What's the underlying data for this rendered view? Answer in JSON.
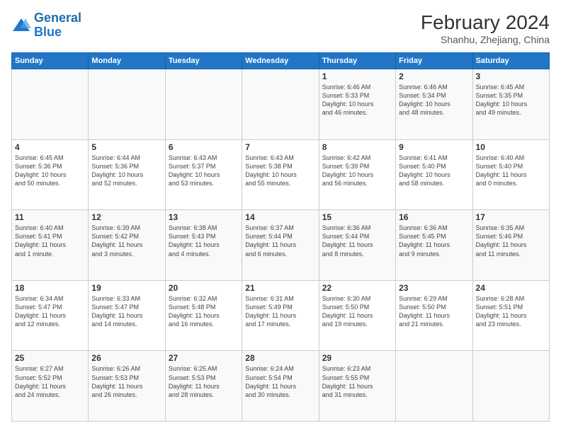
{
  "logo": {
    "line1": "General",
    "line2": "Blue"
  },
  "header": {
    "month_year": "February 2024",
    "location": "Shanhu, Zhejiang, China"
  },
  "weekdays": [
    "Sunday",
    "Monday",
    "Tuesday",
    "Wednesday",
    "Thursday",
    "Friday",
    "Saturday"
  ],
  "weeks": [
    [
      {
        "day": "",
        "info": ""
      },
      {
        "day": "",
        "info": ""
      },
      {
        "day": "",
        "info": ""
      },
      {
        "day": "",
        "info": ""
      },
      {
        "day": "1",
        "info": "Sunrise: 6:46 AM\nSunset: 5:33 PM\nDaylight: 10 hours\nand 46 minutes."
      },
      {
        "day": "2",
        "info": "Sunrise: 6:46 AM\nSunset: 5:34 PM\nDaylight: 10 hours\nand 48 minutes."
      },
      {
        "day": "3",
        "info": "Sunrise: 6:45 AM\nSunset: 5:35 PM\nDaylight: 10 hours\nand 49 minutes."
      }
    ],
    [
      {
        "day": "4",
        "info": "Sunrise: 6:45 AM\nSunset: 5:36 PM\nDaylight: 10 hours\nand 50 minutes."
      },
      {
        "day": "5",
        "info": "Sunrise: 6:44 AM\nSunset: 5:36 PM\nDaylight: 10 hours\nand 52 minutes."
      },
      {
        "day": "6",
        "info": "Sunrise: 6:43 AM\nSunset: 5:37 PM\nDaylight: 10 hours\nand 53 minutes."
      },
      {
        "day": "7",
        "info": "Sunrise: 6:43 AM\nSunset: 5:38 PM\nDaylight: 10 hours\nand 55 minutes."
      },
      {
        "day": "8",
        "info": "Sunrise: 6:42 AM\nSunset: 5:39 PM\nDaylight: 10 hours\nand 56 minutes."
      },
      {
        "day": "9",
        "info": "Sunrise: 6:41 AM\nSunset: 5:40 PM\nDaylight: 10 hours\nand 58 minutes."
      },
      {
        "day": "10",
        "info": "Sunrise: 6:40 AM\nSunset: 5:40 PM\nDaylight: 11 hours\nand 0 minutes."
      }
    ],
    [
      {
        "day": "11",
        "info": "Sunrise: 6:40 AM\nSunset: 5:41 PM\nDaylight: 11 hours\nand 1 minute."
      },
      {
        "day": "12",
        "info": "Sunrise: 6:39 AM\nSunset: 5:42 PM\nDaylight: 11 hours\nand 3 minutes."
      },
      {
        "day": "13",
        "info": "Sunrise: 6:38 AM\nSunset: 5:43 PM\nDaylight: 11 hours\nand 4 minutes."
      },
      {
        "day": "14",
        "info": "Sunrise: 6:37 AM\nSunset: 5:44 PM\nDaylight: 11 hours\nand 6 minutes."
      },
      {
        "day": "15",
        "info": "Sunrise: 6:36 AM\nSunset: 5:44 PM\nDaylight: 11 hours\nand 8 minutes."
      },
      {
        "day": "16",
        "info": "Sunrise: 6:36 AM\nSunset: 5:45 PM\nDaylight: 11 hours\nand 9 minutes."
      },
      {
        "day": "17",
        "info": "Sunrise: 6:35 AM\nSunset: 5:46 PM\nDaylight: 11 hours\nand 11 minutes."
      }
    ],
    [
      {
        "day": "18",
        "info": "Sunrise: 6:34 AM\nSunset: 5:47 PM\nDaylight: 11 hours\nand 12 minutes."
      },
      {
        "day": "19",
        "info": "Sunrise: 6:33 AM\nSunset: 5:47 PM\nDaylight: 11 hours\nand 14 minutes."
      },
      {
        "day": "20",
        "info": "Sunrise: 6:32 AM\nSunset: 5:48 PM\nDaylight: 11 hours\nand 16 minutes."
      },
      {
        "day": "21",
        "info": "Sunrise: 6:31 AM\nSunset: 5:49 PM\nDaylight: 11 hours\nand 17 minutes."
      },
      {
        "day": "22",
        "info": "Sunrise: 6:30 AM\nSunset: 5:50 PM\nDaylight: 11 hours\nand 19 minutes."
      },
      {
        "day": "23",
        "info": "Sunrise: 6:29 AM\nSunset: 5:50 PM\nDaylight: 11 hours\nand 21 minutes."
      },
      {
        "day": "24",
        "info": "Sunrise: 6:28 AM\nSunset: 5:51 PM\nDaylight: 11 hours\nand 23 minutes."
      }
    ],
    [
      {
        "day": "25",
        "info": "Sunrise: 6:27 AM\nSunset: 5:52 PM\nDaylight: 11 hours\nand 24 minutes."
      },
      {
        "day": "26",
        "info": "Sunrise: 6:26 AM\nSunset: 5:53 PM\nDaylight: 11 hours\nand 26 minutes."
      },
      {
        "day": "27",
        "info": "Sunrise: 6:25 AM\nSunset: 5:53 PM\nDaylight: 11 hours\nand 28 minutes."
      },
      {
        "day": "28",
        "info": "Sunrise: 6:24 AM\nSunset: 5:54 PM\nDaylight: 11 hours\nand 30 minutes."
      },
      {
        "day": "29",
        "info": "Sunrise: 6:23 AM\nSunset: 5:55 PM\nDaylight: 11 hours\nand 31 minutes."
      },
      {
        "day": "",
        "info": ""
      },
      {
        "day": "",
        "info": ""
      }
    ]
  ]
}
